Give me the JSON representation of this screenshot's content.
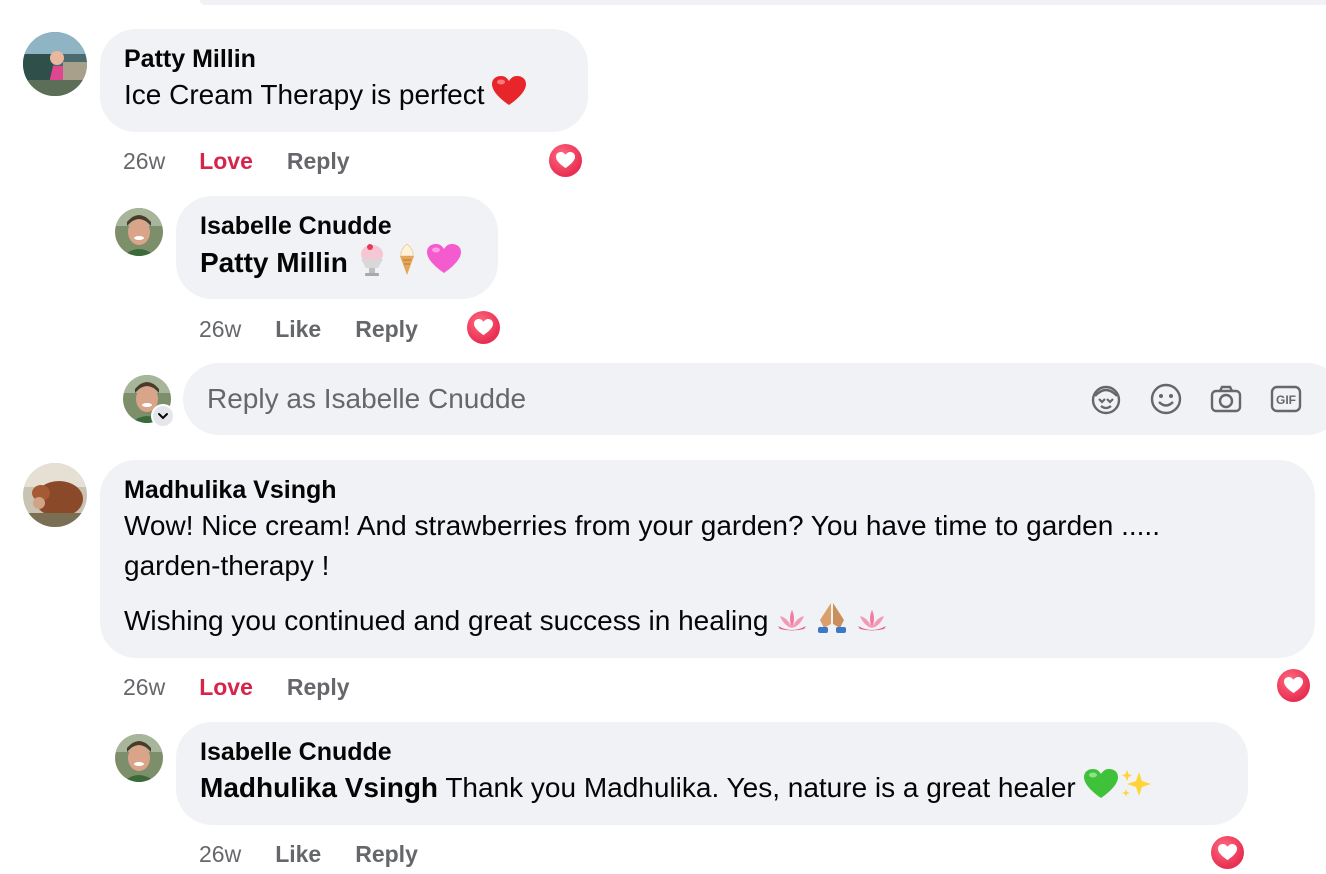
{
  "comments": [
    {
      "author": "Patty Millin",
      "text": "Ice Cream Therapy is perfect",
      "time": "26w",
      "reaction_action": "Love",
      "reply_action": "Reply",
      "emoji": "red-heart"
    },
    {
      "author": "Isabelle Cnudde",
      "mention": "Patty Millin",
      "time": "26w",
      "reaction_action": "Like",
      "reply_action": "Reply",
      "emoji": [
        "shaved-ice",
        "soft-ice-cream",
        "pink-heart"
      ]
    },
    {
      "author": "Madhulika Vsingh",
      "text_line1": "Wow! Nice cream! And strawberries from your garden? You have time to garden .....",
      "text_line2": "garden-therapy !",
      "text_para2": "Wishing you continued and great success in healing",
      "time": "26w",
      "reaction_action": "Love",
      "reply_action": "Reply",
      "emoji": [
        "lotus",
        "folded-hands",
        "lotus"
      ]
    },
    {
      "author": "Isabelle Cnudde",
      "mention": "Madhulika Vsingh",
      "text": "Thank you Madhulika. Yes, nature is a great healer",
      "time": "26w",
      "reaction_action": "Like",
      "reply_action": "Reply",
      "emoji": [
        "green-heart",
        "sparkles"
      ]
    }
  ],
  "reply_box": {
    "placeholder": "Reply as Isabelle Cnudde",
    "icons": [
      "avatar-sticker-icon",
      "emoji-icon",
      "camera-icon",
      "gif-icon",
      "sticker-icon"
    ]
  },
  "colors": {
    "bubble": "#f0f2f5",
    "love": "#d6244a",
    "muted": "#65676b",
    "heart": "#e82e52"
  }
}
